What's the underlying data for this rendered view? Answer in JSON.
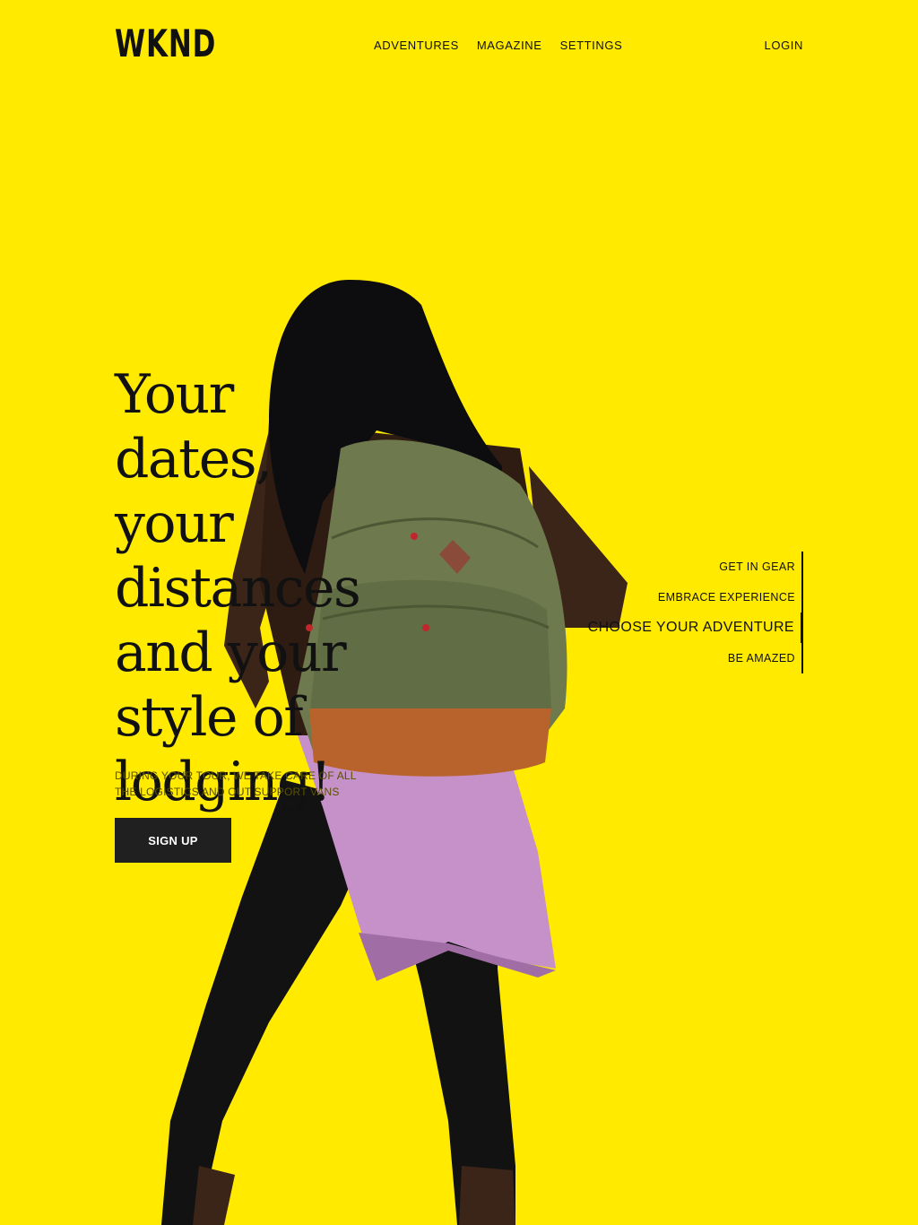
{
  "header": {
    "logo": "WKND",
    "nav": [
      "ADVENTURES",
      "MAGAZINE",
      "SETTINGS"
    ],
    "login": "LOGIN"
  },
  "hero": {
    "headline": "Your dates, your distances and your style of lodging!",
    "subtext": "DURING YOUR TOUR, WE TAKE CARE OF ALL THE LOGISTICS AND OUT SUPPORT VANS",
    "cta_label": "SIGN UP"
  },
  "steps": {
    "items": [
      "GET IN GEAR",
      "EMBRACE EXPERIENCE",
      "CHOOSE YOUR ADVENTURE",
      "BE AMAZED"
    ],
    "active_index": 2
  },
  "colors": {
    "background": "#FFEA00",
    "button": "#202020",
    "text": "#111111"
  }
}
